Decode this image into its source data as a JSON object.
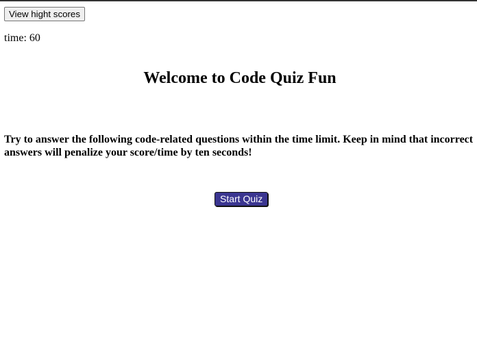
{
  "header": {
    "highscores_label": "View hight scores"
  },
  "timer": {
    "text": "time: 60"
  },
  "main": {
    "title": "Welcome to Code Quiz Fun",
    "intro": "Try to answer the following code-related questions within the time limit. Keep in mind that incorrect answers will penalize your score/time by ten seconds!",
    "start_label": "Start Quiz"
  },
  "colors": {
    "start_button_bg": "#3b3691",
    "start_button_text": "#ffffff",
    "page_bg": "#ffffff"
  }
}
